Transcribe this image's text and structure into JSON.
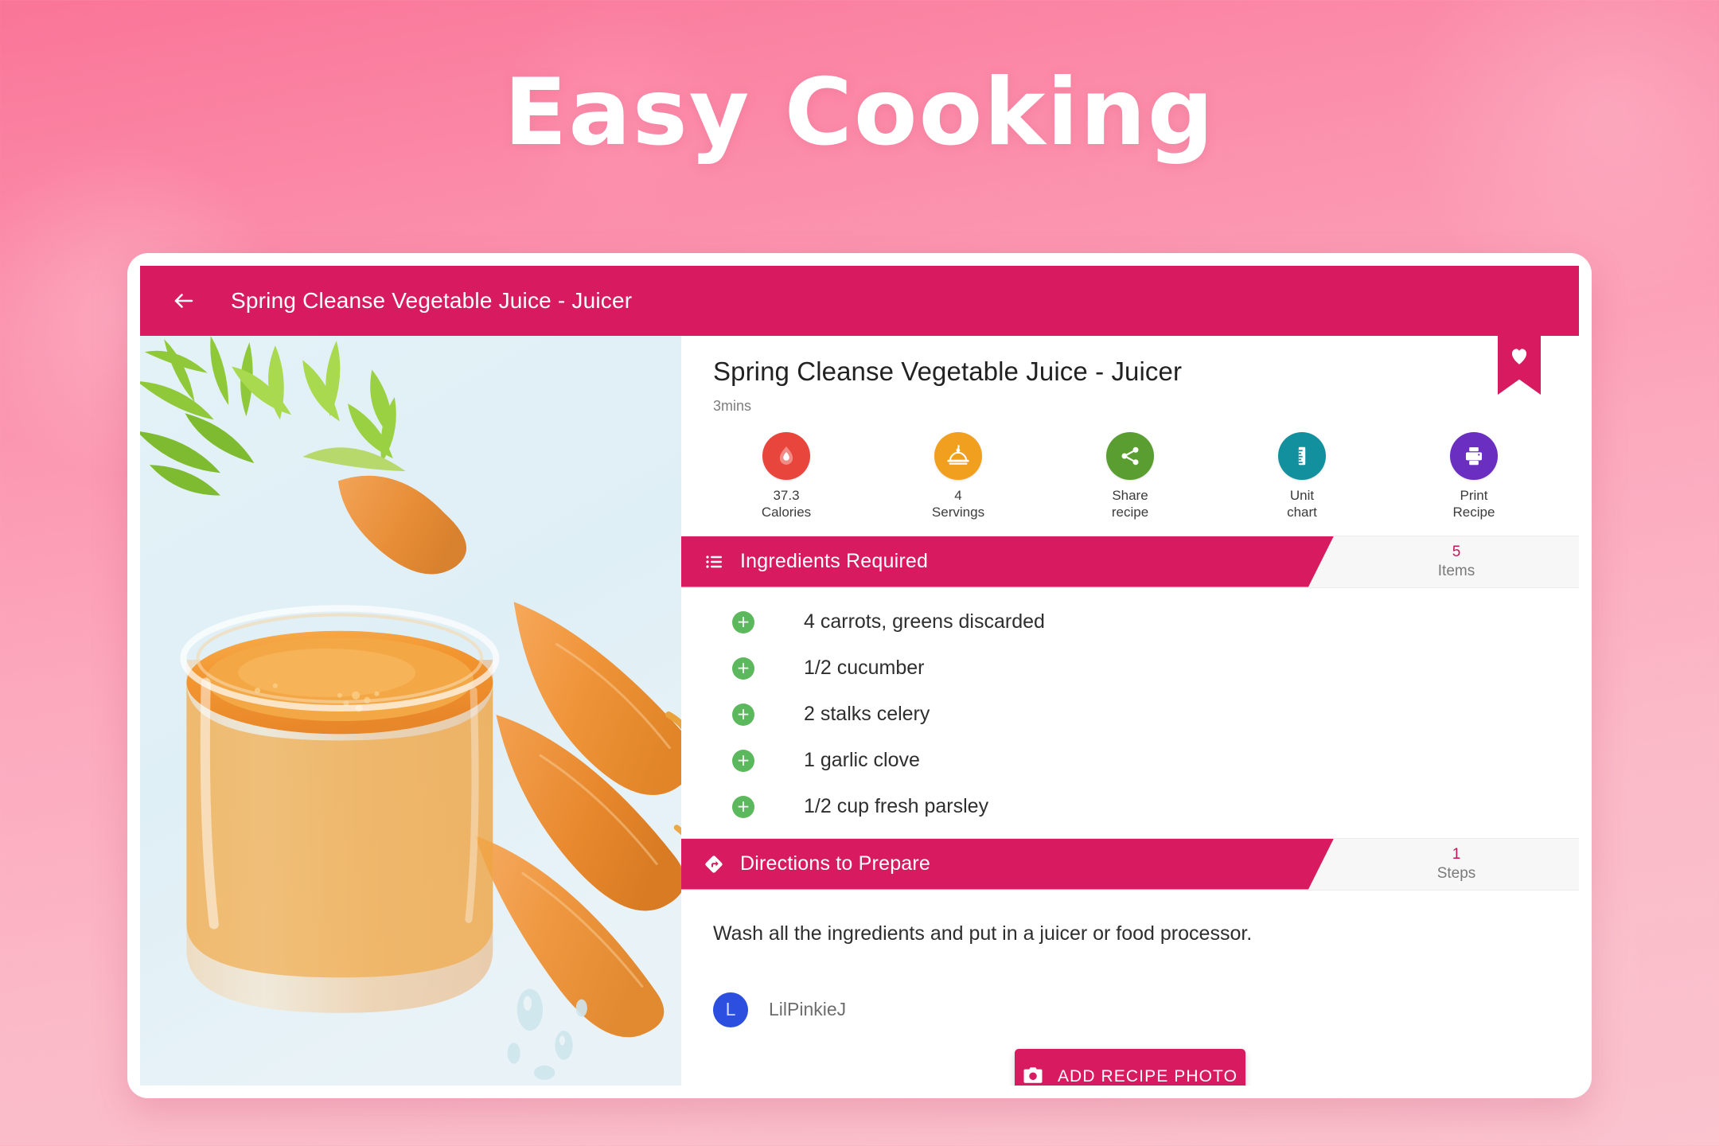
{
  "headline": "Easy Cooking",
  "appbar": {
    "back_icon": "arrow-left-icon",
    "title": "Spring Cleanse Vegetable Juice - Juicer"
  },
  "photo": {
    "alt": "glass of carrot juice with whole carrots and carrot greens on a pale blue surface"
  },
  "recipe": {
    "title": "Spring Cleanse Vegetable Juice - Juicer",
    "time": "3mins",
    "bookmark_icon": "heart-icon"
  },
  "actions": [
    {
      "icon": "flame-drop-icon",
      "value": "37.3",
      "label": "Calories",
      "color": "#e8453c"
    },
    {
      "icon": "cloche-icon",
      "value": "4",
      "label": "Servings",
      "color": "#f0a01e"
    },
    {
      "icon": "share-icon",
      "value": "Share",
      "label": "recipe",
      "color": "#5a9e32"
    },
    {
      "icon": "ruler-icon",
      "value": "Unit",
      "label": "chart",
      "color": "#13909e"
    },
    {
      "icon": "printer-icon",
      "value": "Print",
      "label": "Recipe",
      "color": "#6a2fc0"
    }
  ],
  "ingredients_section": {
    "icon": "list-icon",
    "label": "Ingredients Required",
    "count": "5",
    "count_unit": "Items",
    "items": [
      {
        "add_icon": "plus-icon",
        "text": "4 carrots, greens discarded"
      },
      {
        "add_icon": "plus-icon",
        "text": "1/2 cucumber"
      },
      {
        "add_icon": "plus-icon",
        "text": "2 stalks celery"
      },
      {
        "add_icon": "plus-icon",
        "text": "1 garlic clove"
      },
      {
        "add_icon": "plus-icon",
        "text": "1/2 cup fresh parsley"
      }
    ]
  },
  "directions_section": {
    "icon": "directions-diamond-icon",
    "label": "Directions to Prepare",
    "count": "1",
    "count_unit": "Steps",
    "steps": [
      "Wash all the ingredients and put in a juicer or food processor."
    ]
  },
  "author": {
    "initial": "L",
    "name": "LilPinkieJ"
  },
  "add_photo_button": {
    "icon": "camera-icon",
    "label": "ADD RECIPE PHOTO"
  },
  "colors": {
    "primary_pink": "#d81b60",
    "background_top": "#fa7598",
    "background_bottom": "#fac3ce",
    "counter_num": "#c2185b",
    "plus_green": "#5cb85c",
    "avatar_blue": "#2d4fe0"
  }
}
